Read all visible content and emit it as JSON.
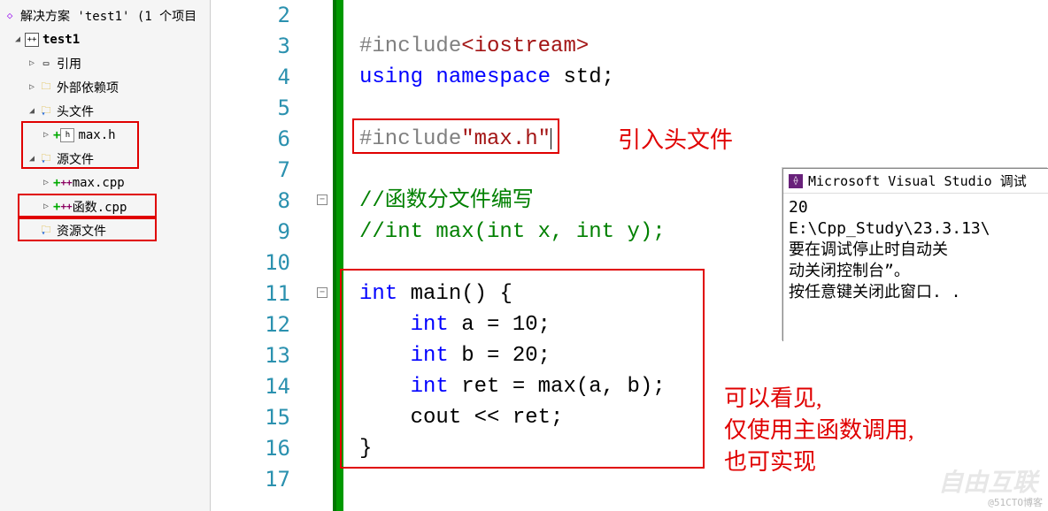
{
  "sidebar": {
    "sln": "解决方案 'test1' (1 个项目",
    "proj": "test1",
    "refs": "引用",
    "external": "外部依赖项",
    "headers": "头文件",
    "max_h": "max.h",
    "sources": "源文件",
    "max_cpp": "max.cpp",
    "func_cpp": "函数.cpp",
    "resources": "资源文件"
  },
  "gutter": [
    "2",
    "3",
    "4",
    "5",
    "6",
    "7",
    "8",
    "9",
    "10",
    "11",
    "12",
    "13",
    "14",
    "15",
    "16",
    "17"
  ],
  "code": {
    "l3a": "#include",
    "l3b": "<iostream>",
    "l4a": "using",
    "l4b": "namespace",
    "l4c": " std;",
    "l6a": "#include",
    "l6b": "\"max.h\"",
    "l8": "//函数分文件编写",
    "l9": "//int max(int x, int y);",
    "l11a": "int",
    "l11b": " main() {",
    "l12a": "int",
    "l12b": " a = 10;",
    "l13a": "int",
    "l13b": " b = 20;",
    "l14a": "int",
    "l14b": " ret = max(a, b);",
    "l15": "cout << ret;",
    "l16": "}"
  },
  "annotations": {
    "include_header": "引入头文件",
    "can_see": "可以看见,",
    "only_main": "仅使用主函数调用,",
    "also_works": "也可实现"
  },
  "console": {
    "title": "Microsoft Visual Studio 调试",
    "body": "20\nE:\\Cpp_Study\\23.3.13\\\n要在调试停止时自动关\n动关闭控制台”。\n按任意键关闭此窗口. ."
  },
  "watermark": "@51CTO博客",
  "xlogo": "自由互联"
}
